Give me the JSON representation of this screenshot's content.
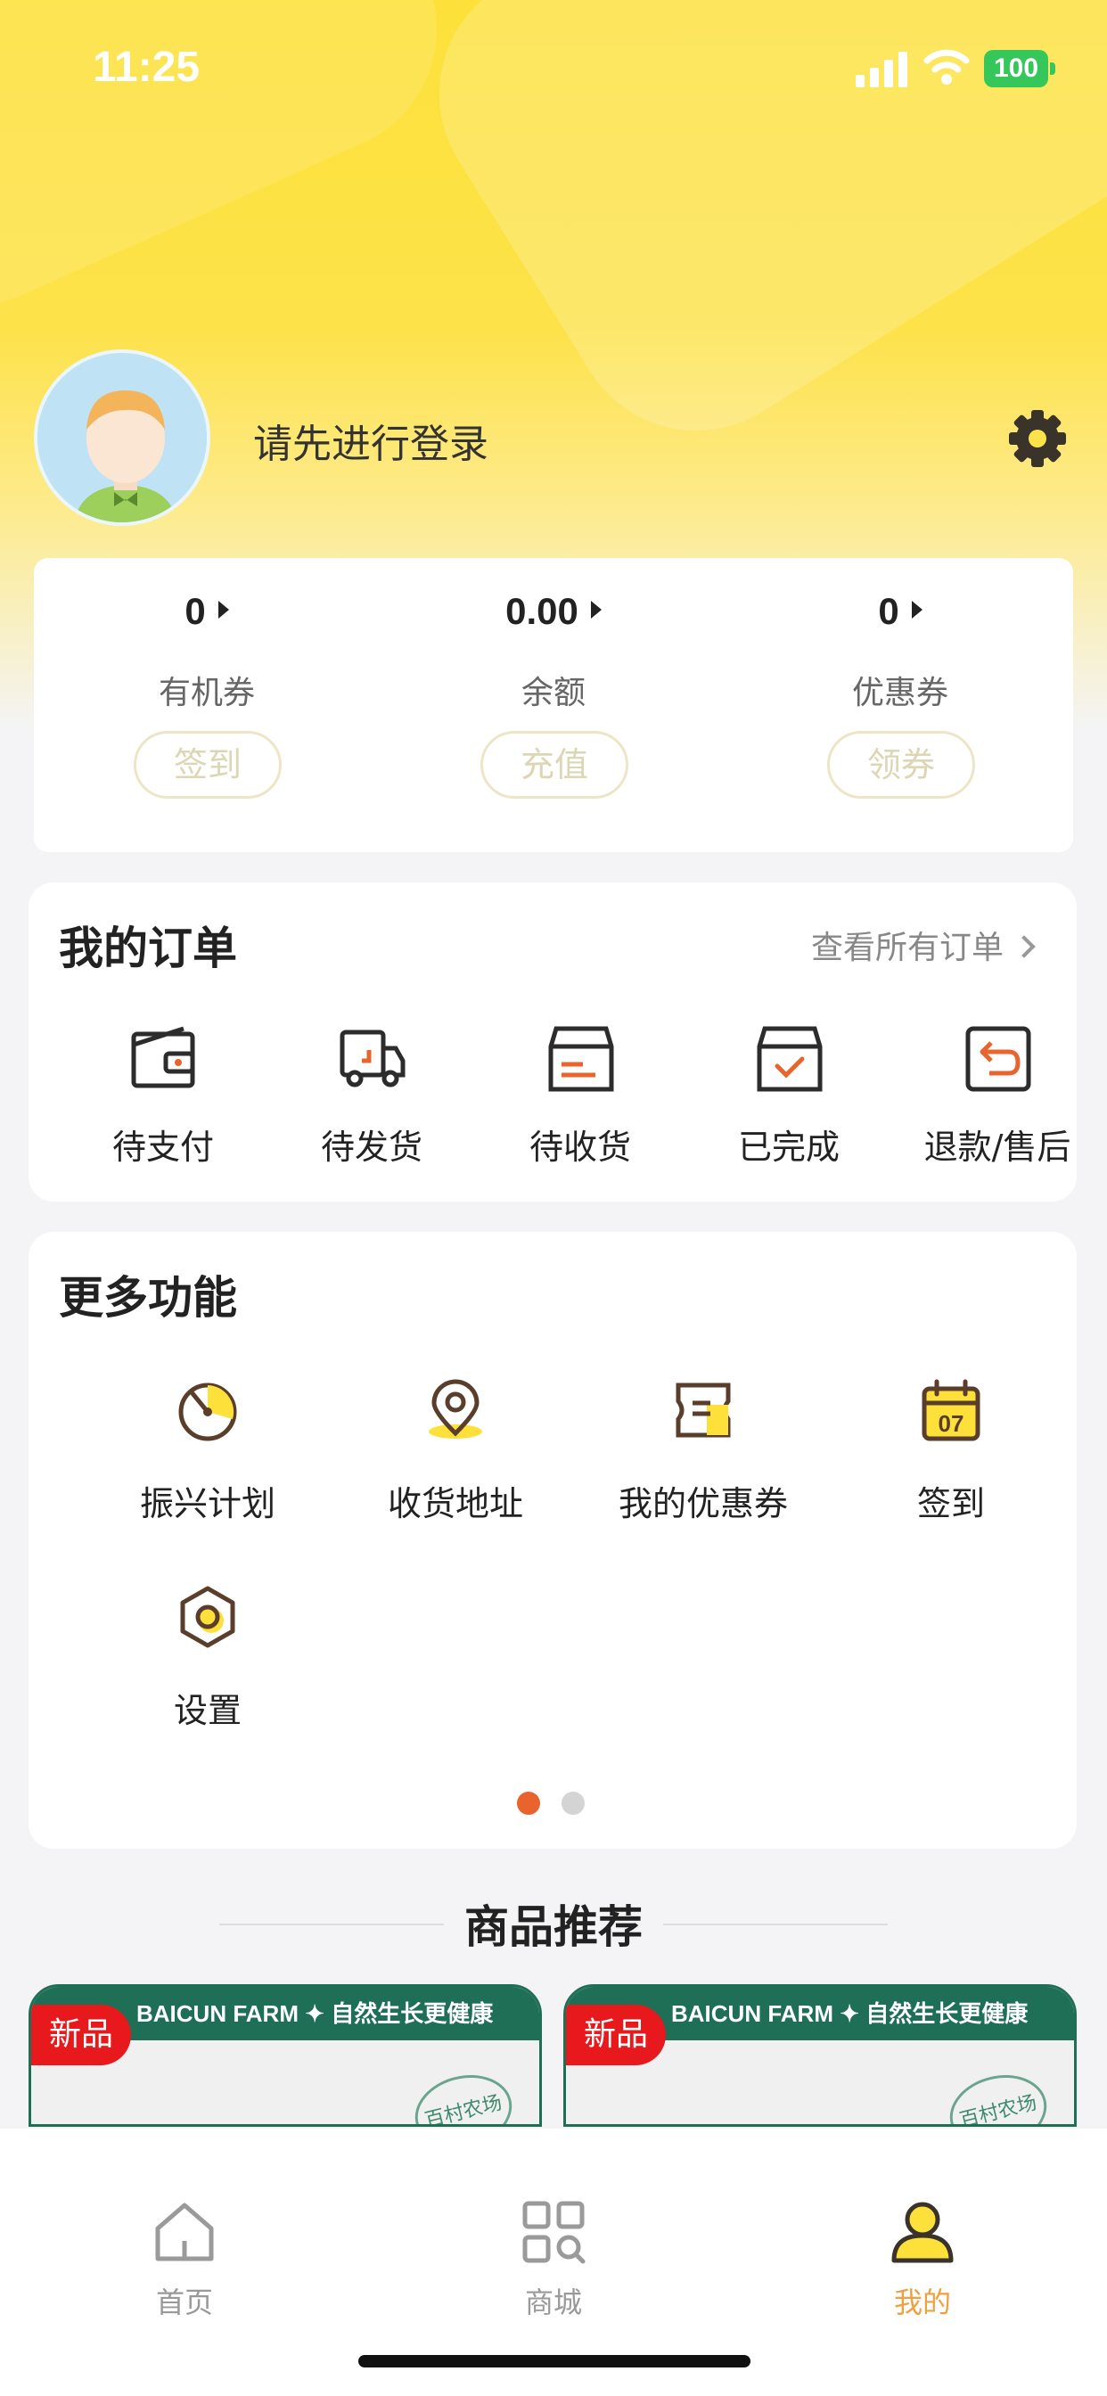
{
  "status_bar": {
    "time": "11:25",
    "battery": "100"
  },
  "profile": {
    "login_prompt": "请先进行登录"
  },
  "wallet": [
    {
      "value": "0",
      "label": "有机券",
      "button": "签到"
    },
    {
      "value": "0.00",
      "label": "余额",
      "button": "充值"
    },
    {
      "value": "0",
      "label": "优惠券",
      "button": "领券"
    }
  ],
  "orders": {
    "title": "我的订单",
    "view_all": "查看所有订单",
    "items": [
      {
        "label": "待支付",
        "icon": "wallet-icon"
      },
      {
        "label": "待发货",
        "icon": "truck-icon"
      },
      {
        "label": "待收货",
        "icon": "box-icon"
      },
      {
        "label": "已完成",
        "icon": "box-check-icon"
      },
      {
        "label": "退款/售后",
        "icon": "return-icon"
      }
    ]
  },
  "more": {
    "title": "更多功能",
    "items": [
      {
        "label": "振兴计划",
        "icon": "gauge-icon"
      },
      {
        "label": "收货地址",
        "icon": "location-pin-icon"
      },
      {
        "label": "我的优惠券",
        "icon": "coupon-icon"
      },
      {
        "label": "签到",
        "icon": "calendar-icon",
        "badge": "07"
      },
      {
        "label": "设置",
        "icon": "hexagon-settings-icon"
      }
    ],
    "page": {
      "current": 1,
      "total": 2
    }
  },
  "recommend": {
    "title": "商品推荐",
    "products": [
      {
        "tag": "新品",
        "banner": "BAICUN FARM ✦ 自然生长更健康",
        "stamp": "百村农场"
      },
      {
        "tag": "新品",
        "banner": "BAICUN FARM ✦ 自然生长更健康",
        "stamp": "百村农场"
      }
    ]
  },
  "tabbar": [
    {
      "label": "首页",
      "icon": "home-icon",
      "active": false
    },
    {
      "label": "商城",
      "icon": "grid-search-icon",
      "active": false
    },
    {
      "label": "我的",
      "icon": "user-icon",
      "active": true
    }
  ],
  "colors": {
    "brand_yellow": "#fde13a",
    "accent_orange": "#e8642c",
    "active_tab": "#f0a040",
    "product_green": "#1f6f57",
    "new_tag_red": "#e8191c"
  }
}
